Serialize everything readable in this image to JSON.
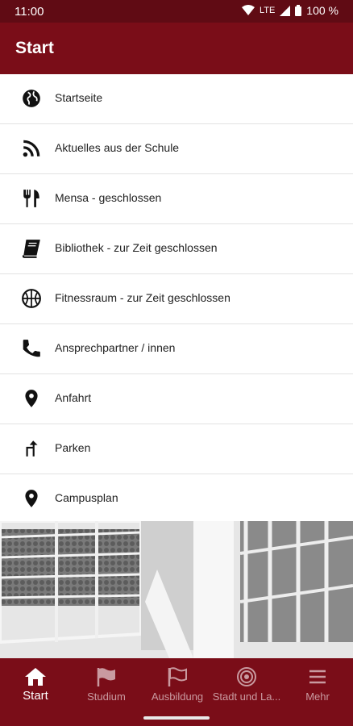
{
  "status": {
    "time": "11:00",
    "network": "LTE",
    "battery": "100 %"
  },
  "appbar": {
    "title": "Start"
  },
  "menu": [
    {
      "label": "Startseite",
      "icon": "globe-icon"
    },
    {
      "label": "Aktuelles aus der Schule",
      "icon": "rss-icon"
    },
    {
      "label": "Mensa - geschlossen",
      "icon": "utensils-icon"
    },
    {
      "label": "Bibliothek - zur Zeit geschlossen",
      "icon": "book-icon"
    },
    {
      "label": "Fitnessraum - zur Zeit geschlossen",
      "icon": "basketball-icon"
    },
    {
      "label": "Ansprechpartner / innen",
      "icon": "phone-icon"
    },
    {
      "label": "Anfahrt",
      "icon": "map-pin-icon"
    },
    {
      "label": "Parken",
      "icon": "turn-arrow-icon"
    },
    {
      "label": "Campusplan",
      "icon": "map-pin-icon"
    }
  ],
  "tabs": [
    {
      "label": "Start",
      "icon": "home-icon",
      "active": true
    },
    {
      "label": "Studium",
      "icon": "flag-icon",
      "active": false
    },
    {
      "label": "Ausbildung",
      "icon": "flag-outline-icon",
      "active": false
    },
    {
      "label": "Stadt und La...",
      "icon": "target-icon",
      "active": false
    },
    {
      "label": "Mehr",
      "icon": "menu-icon",
      "active": false
    }
  ],
  "colors": {
    "brand": "#7a0d18",
    "statusbar": "#600b14"
  }
}
